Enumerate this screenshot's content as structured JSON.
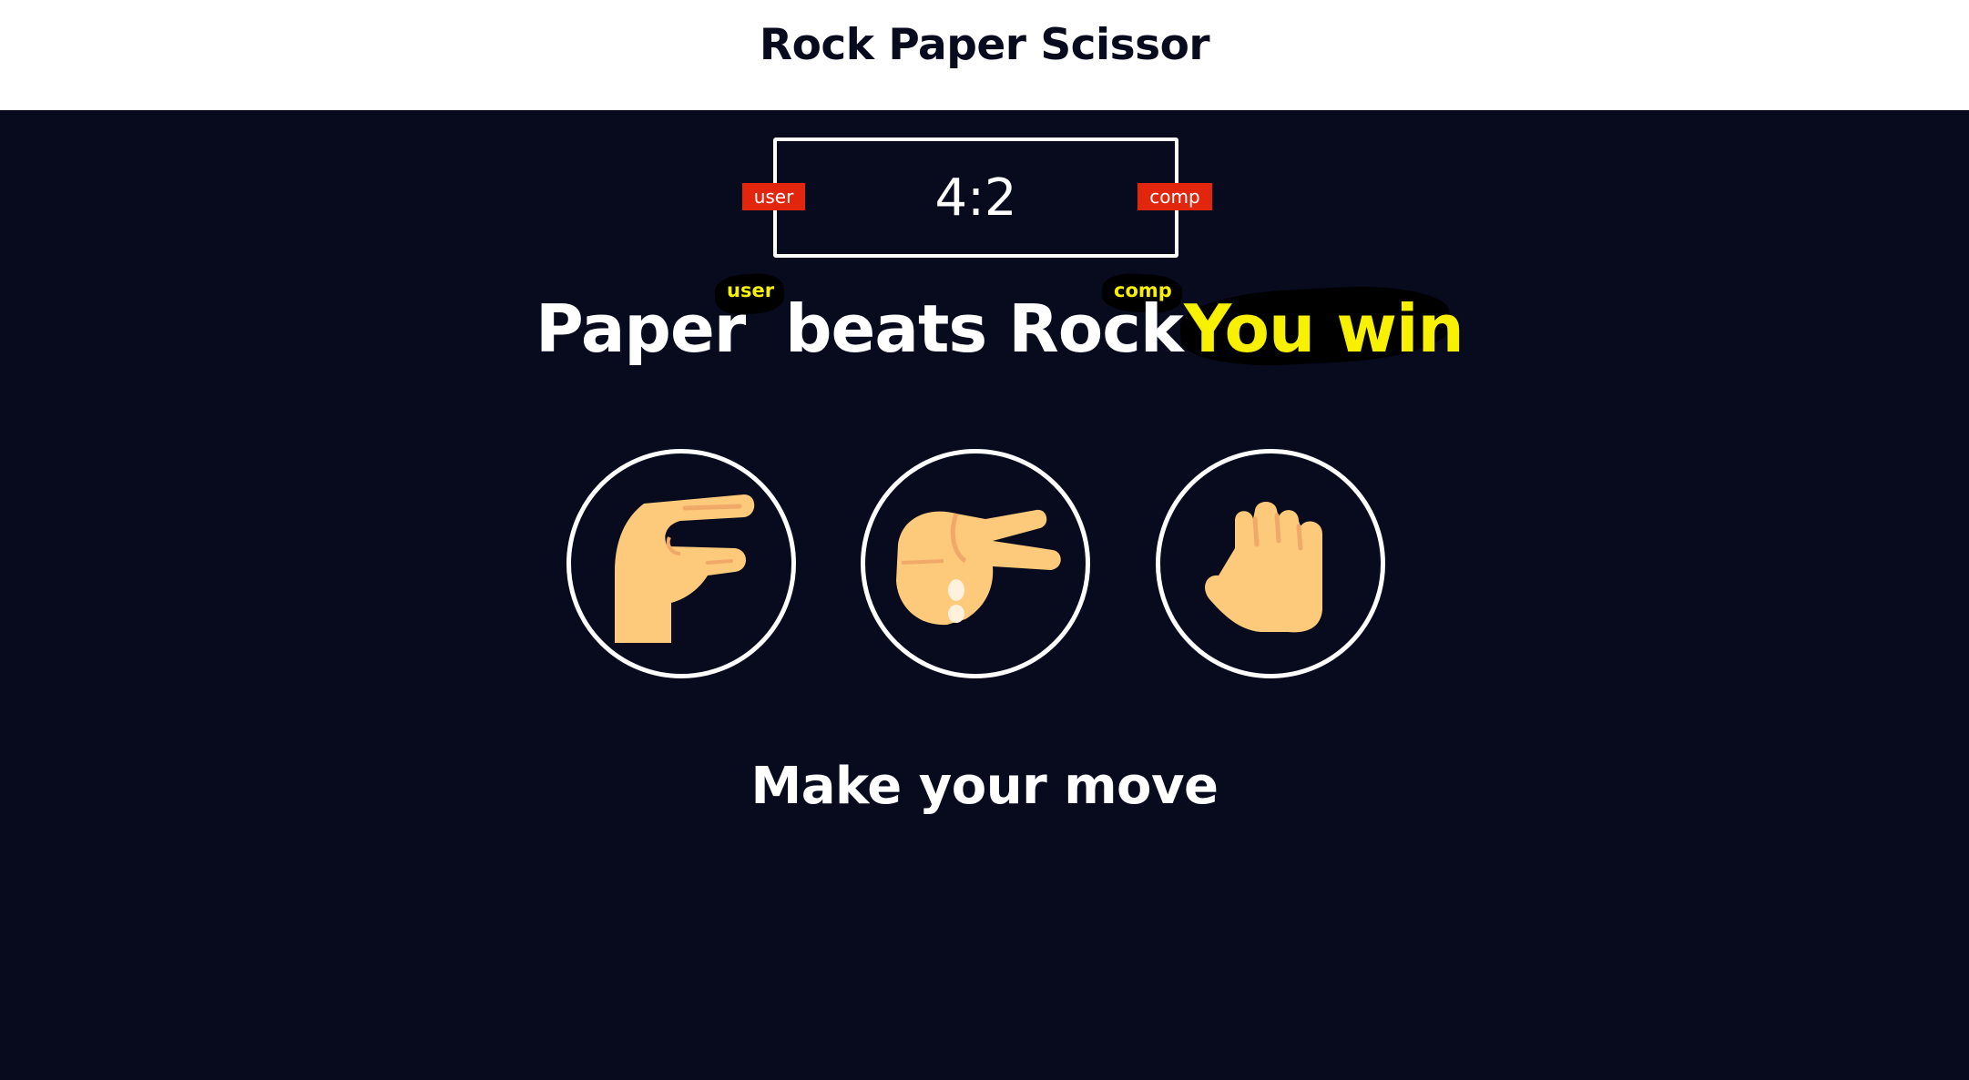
{
  "header": {
    "title": "Rock Paper Scissor"
  },
  "score": {
    "value": "4:2",
    "user_label": "user",
    "comp_label": "comp"
  },
  "result": {
    "user_choice": "Paper",
    "user_tag": "user",
    "verb_and_comp_choice": "beats Rock",
    "comp_tag": "comp",
    "outcome": "You win"
  },
  "choices": [
    {
      "name": "paper",
      "icon": "paper-hand-icon"
    },
    {
      "name": "scissor",
      "icon": "scissor-hand-icon"
    },
    {
      "name": "rock",
      "icon": "rock-fist-icon"
    }
  ],
  "prompt": "Make your move",
  "colors": {
    "background": "#080a1e",
    "header_bg": "#ffffff",
    "badge": "#e2260e",
    "highlight": "#f7f000",
    "skin": "#fdc97b",
    "skin_shadow": "#f1a96a"
  }
}
